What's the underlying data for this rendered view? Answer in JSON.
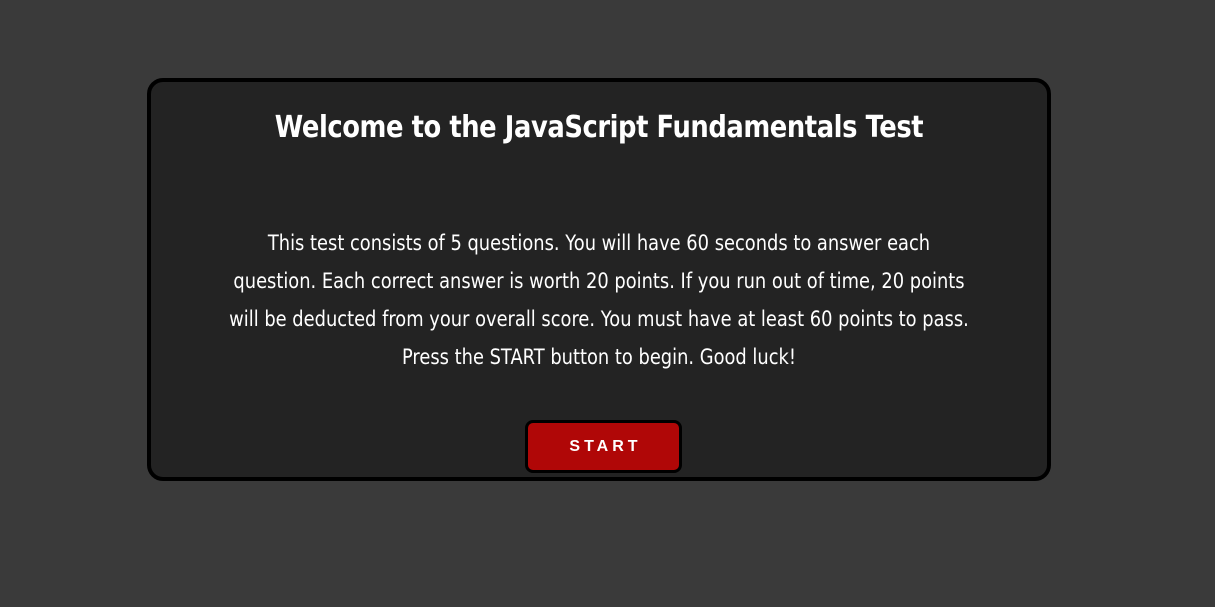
{
  "colors": {
    "page_background": "#3a3a3a",
    "card_background": "#232323",
    "card_border": "#000000",
    "text": "#ffffff",
    "start_button": "#b00707"
  },
  "card": {
    "title": "Welcome to the JavaScript Fundamentals Test",
    "intro_lines": [
      "This test consists of 5 questions. You will have 60 seconds to answer each",
      "question. Each correct answer is worth 20 points. If you run out of time, 20 points",
      "will be deducted from your overall score. You must have at least 60 points to pass.",
      "Press the START button to begin. Good luck!"
    ],
    "start_label": "START"
  }
}
